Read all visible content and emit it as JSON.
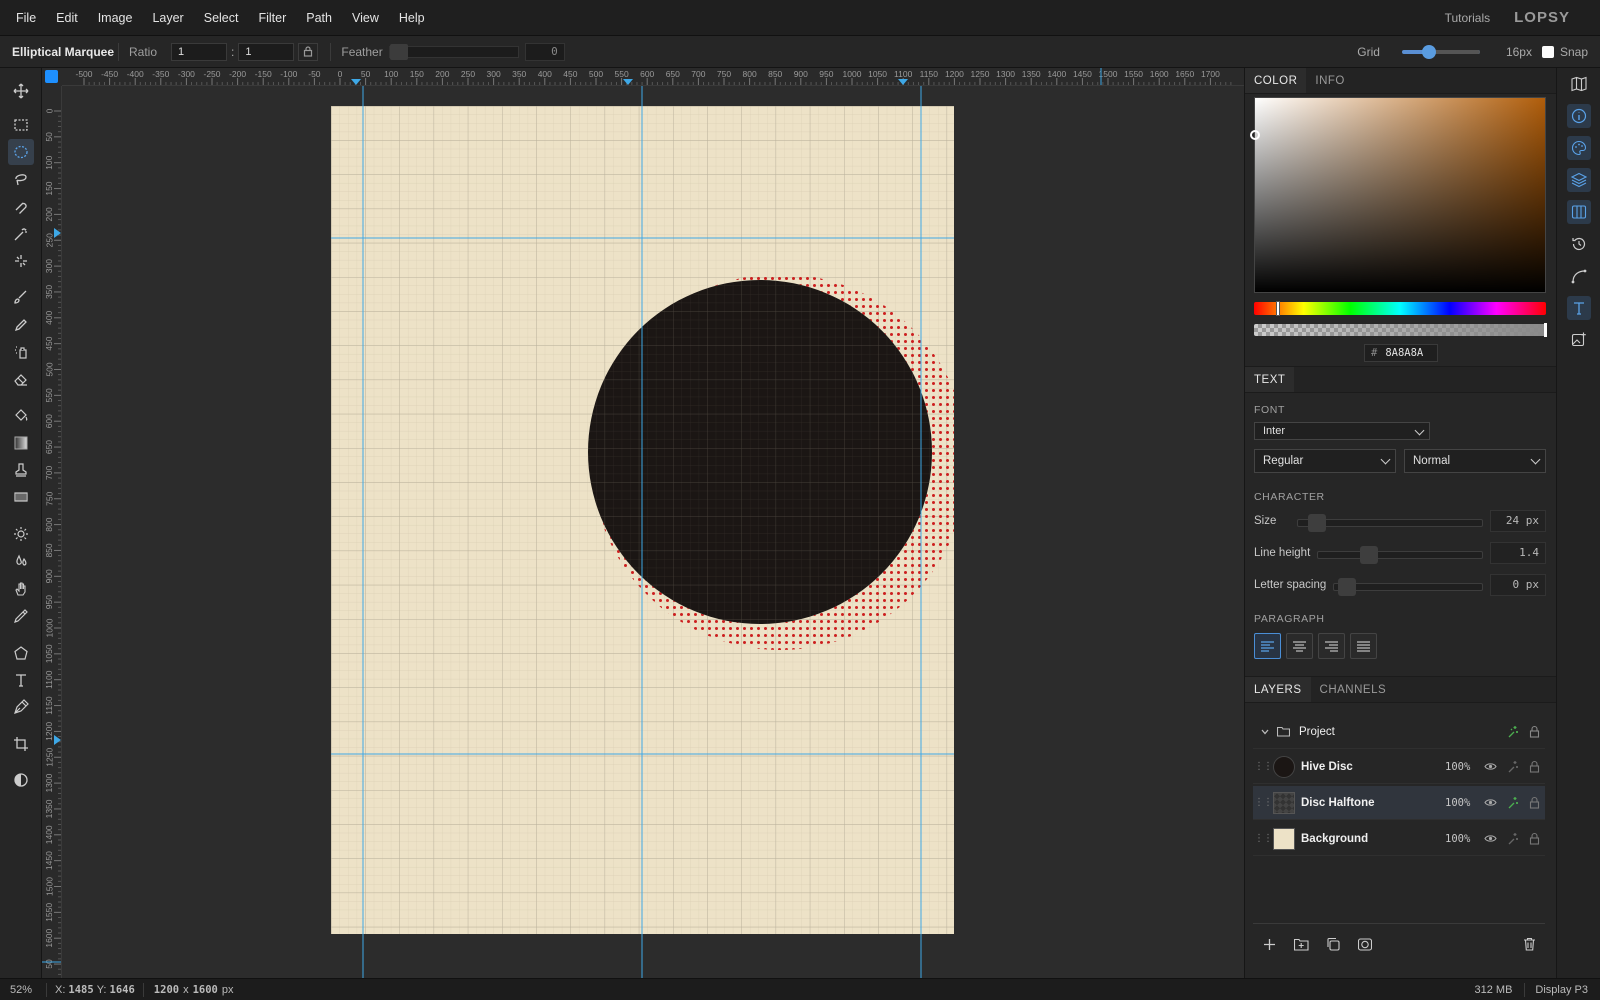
{
  "menu": [
    "File",
    "Edit",
    "Image",
    "Layer",
    "Select",
    "Filter",
    "Path",
    "View",
    "Help"
  ],
  "header": {
    "tutorials": "Tutorials",
    "logo": "LOPSY"
  },
  "options": {
    "tool_name": "Elliptical Marquee",
    "ratio_label": "Ratio",
    "ratio_w": "1",
    "ratio_h": "1",
    "feather_label": "Feather",
    "feather_value": "0",
    "grid_label": "Grid",
    "grid_value": "16px",
    "snap_label": "Snap"
  },
  "rulers": {
    "top": [
      "-500",
      "-450",
      "-400",
      "-350",
      "-300",
      "-250",
      "-200",
      "-150",
      "-100",
      "-50",
      "0",
      "50",
      "100",
      "150",
      "200",
      "250",
      "300",
      "350",
      "400",
      "450",
      "500",
      "550",
      "600",
      "650",
      "700",
      "750",
      "800",
      "850",
      "900",
      "950",
      "1000",
      "1050",
      "1100",
      "1150",
      "1200",
      "1250",
      "1300",
      "1350",
      "1400",
      "1450",
      "1500",
      "1550",
      "1600",
      "1650",
      "1700"
    ],
    "left": [
      "0",
      "50",
      "100",
      "150",
      "200",
      "250",
      "300",
      "350",
      "400",
      "450",
      "500",
      "550",
      "600",
      "650",
      "700",
      "750",
      "800",
      "850",
      "900",
      "950",
      "1000",
      "1050",
      "1100",
      "1150",
      "1200",
      "1250",
      "1300",
      "1350",
      "1400",
      "1450",
      "1500",
      "1550",
      "1600",
      "50"
    ]
  },
  "color_panel": {
    "tabs": [
      "COLOR",
      "INFO"
    ],
    "hex_hash": "#",
    "hex": "8A8A8A",
    "colors": {
      "base_hue": "#b05d0a",
      "current": "#8a8a8a"
    }
  },
  "text_panel": {
    "tab": "TEXT",
    "font_label": "FONT",
    "font_family": "Inter",
    "font_weight": "Regular",
    "font_style": "Normal",
    "character_label": "CHARACTER",
    "size_label": "Size",
    "size_value": "24 px",
    "line_height_label": "Line height",
    "line_height_value": "1.4",
    "letter_spacing_label": "Letter spacing",
    "letter_spacing_value": "0 px",
    "paragraph_label": "PARAGRAPH"
  },
  "layers_panel": {
    "tabs": [
      "LAYERS",
      "CHANNELS"
    ],
    "group": "Project",
    "layers": [
      {
        "name": "Hive Disc",
        "opacity": "100%"
      },
      {
        "name": "Disc Halftone",
        "opacity": "100%"
      },
      {
        "name": "Background",
        "opacity": "100%"
      }
    ]
  },
  "canvas": {
    "paper_color": "#ede2c7",
    "disc_color": "#1b1614",
    "halftone_color": "#cc1f1f",
    "guide_color": "#3ea8e6"
  },
  "status": {
    "zoom": "52%",
    "x_label": "X:",
    "x_value": "1485",
    "y_label": "Y:",
    "y_value": "1646",
    "doc_w": "1200",
    "doc_x": "x",
    "doc_h": "1600",
    "doc_unit": "px",
    "memory": "312 MB",
    "profile": "Display P3"
  }
}
